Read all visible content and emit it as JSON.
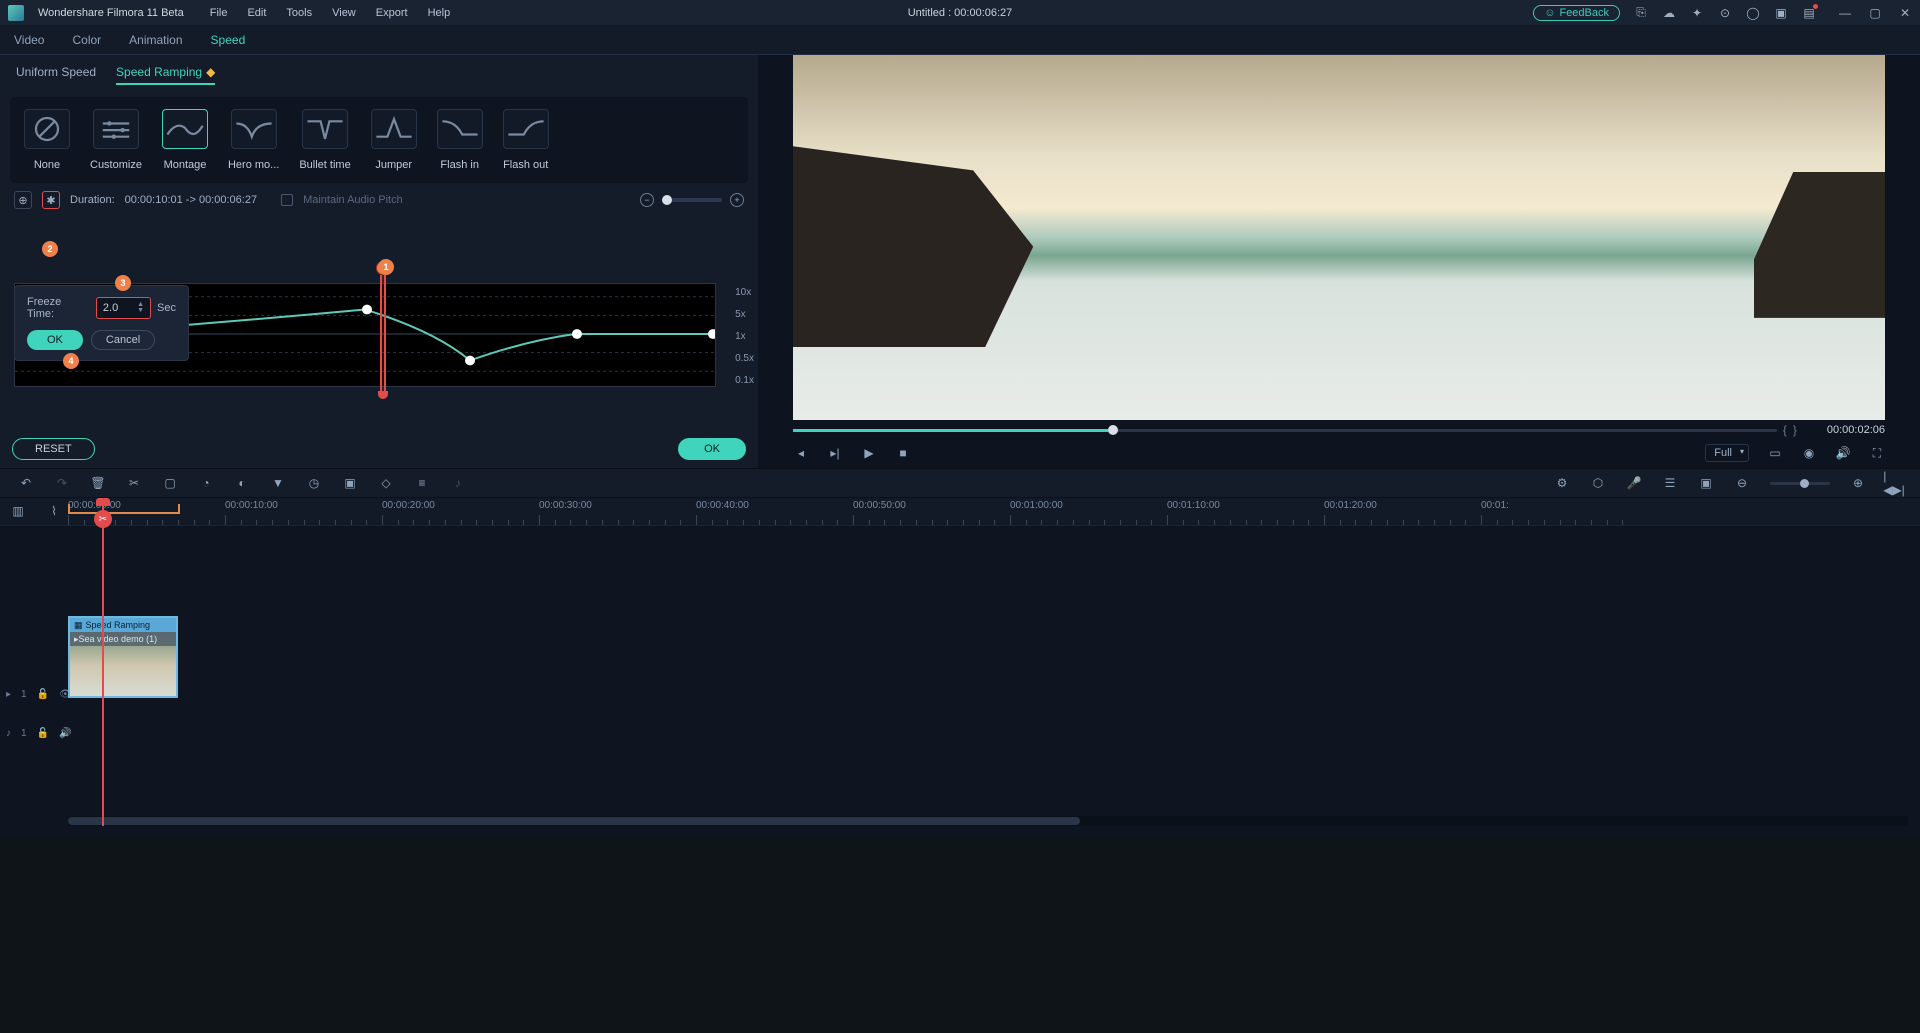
{
  "app": {
    "title": "Wondershare Filmora 11 Beta",
    "project": "Untitled : 00:00:06:27",
    "feedback": "FeedBack"
  },
  "menu": [
    "File",
    "Edit",
    "Tools",
    "View",
    "Export",
    "Help"
  ],
  "panelTabs": [
    "Video",
    "Color",
    "Animation",
    "Speed"
  ],
  "activePanelTab": "Speed",
  "subTabs": {
    "uniform": "Uniform Speed",
    "ramping": "Speed Ramping"
  },
  "presets": [
    "None",
    "Customize",
    "Montage",
    "Hero mo...",
    "Bullet time",
    "Jumper",
    "Flash in",
    "Flash out"
  ],
  "activePreset": "Montage",
  "duration": {
    "label": "Duration:",
    "value": "00:00:10:01 -> 00:00:06:27"
  },
  "maintainPitch": "Maintain Audio Pitch",
  "freeze": {
    "label": "Freeze Time:",
    "value": "2.0",
    "unit": "Sec",
    "ok": "OK",
    "cancel": "Cancel"
  },
  "graphScale": [
    "10x",
    "5x",
    "1x",
    "0.5x",
    "0.1x"
  ],
  "buttons": {
    "reset": "RESET",
    "ok": "OK"
  },
  "preview": {
    "time": "00:00:02:06",
    "quality": "Full"
  },
  "rulerMarks": [
    "00:00:00:00",
    "00:00:10:00",
    "00:00:20:00",
    "00:00:30:00",
    "00:00:40:00",
    "00:00:50:00",
    "00:01:00:00",
    "00:01:10:00",
    "00:01:20:00",
    "00:01:"
  ],
  "clip": {
    "effect": "Speed Ramping",
    "name": "Sea video demo (1)"
  },
  "trackVideo": "1",
  "trackAudio": "1",
  "annotations": {
    "a1": "1",
    "a2": "2",
    "a3": "3",
    "a4": "4"
  }
}
